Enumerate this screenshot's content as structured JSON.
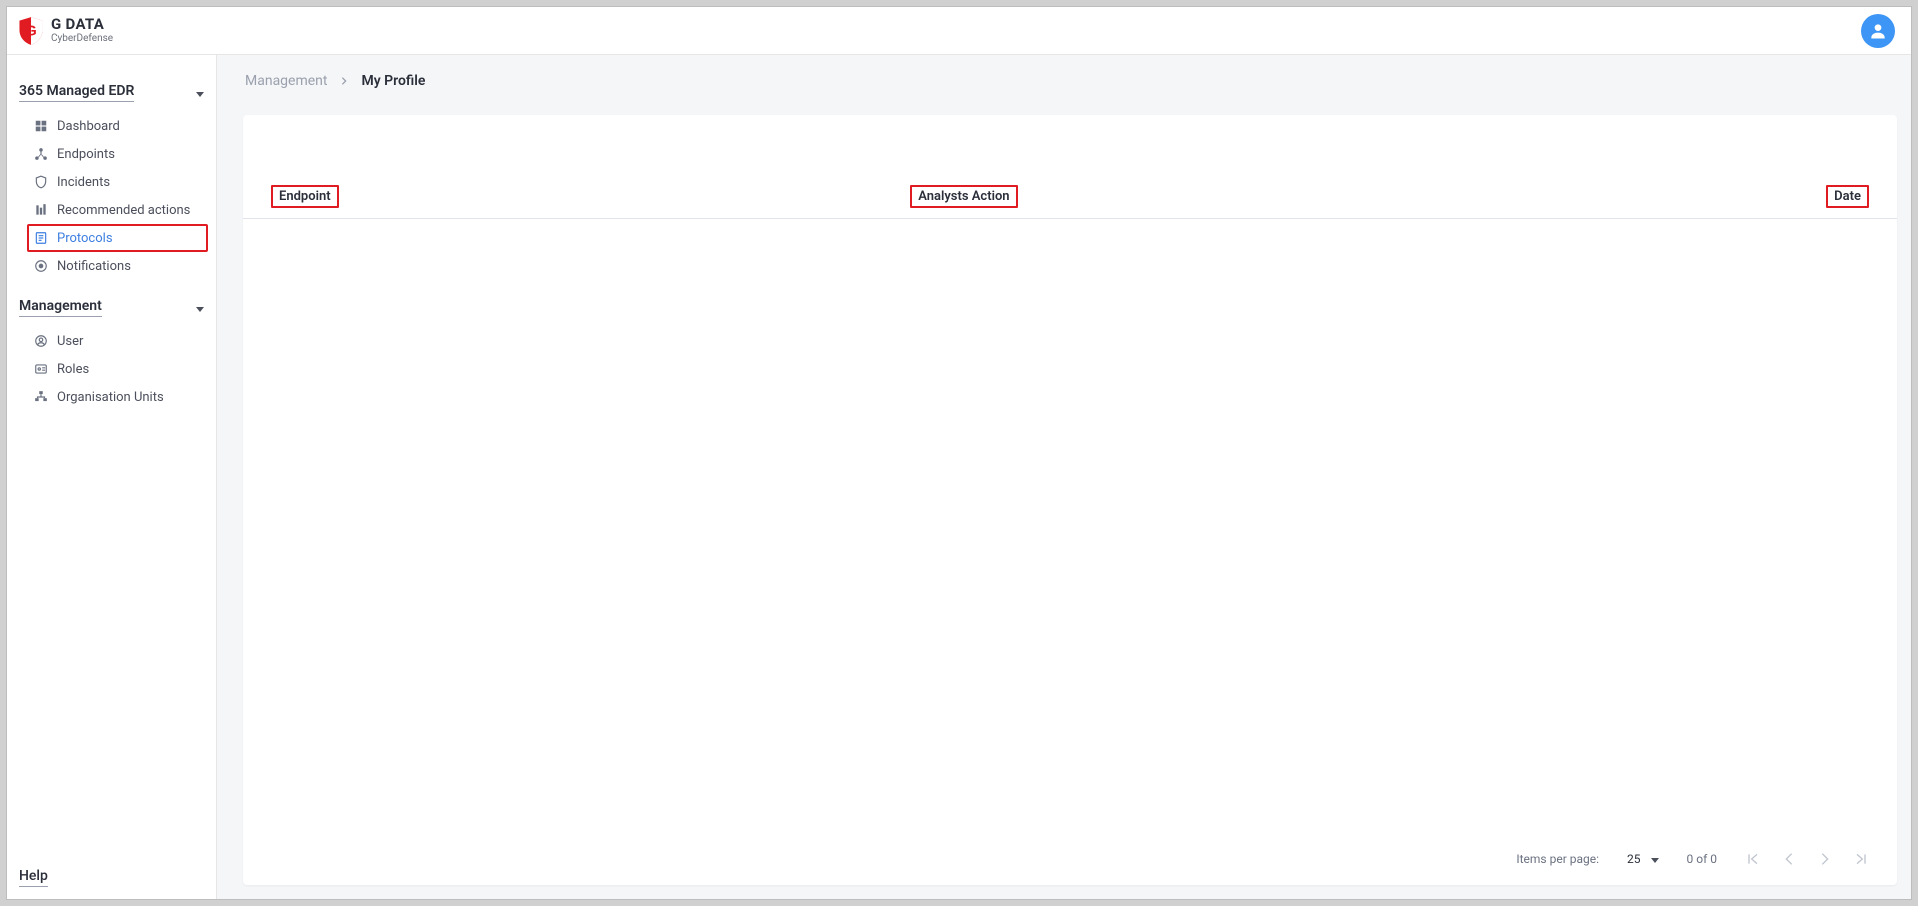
{
  "brand": {
    "main": "G DATA",
    "sub": "CyberDefense"
  },
  "sidebar": {
    "section1": {
      "title": "365 Managed EDR",
      "items": [
        {
          "label": "Dashboard"
        },
        {
          "label": "Endpoints"
        },
        {
          "label": "Incidents"
        },
        {
          "label": "Recommended actions"
        },
        {
          "label": "Protocols"
        },
        {
          "label": "Notifications"
        }
      ]
    },
    "section2": {
      "title": "Management",
      "items": [
        {
          "label": "User"
        },
        {
          "label": "Roles"
        },
        {
          "label": "Organisation Units"
        }
      ]
    },
    "help": "Help"
  },
  "breadcrumb": {
    "root": "Management",
    "current": "My Profile"
  },
  "table": {
    "columns": {
      "endpoint": "Endpoint",
      "action": "Analysts Action",
      "date": "Date"
    }
  },
  "pager": {
    "items_per_page_label": "Items per page:",
    "items_per_page_value": "25",
    "range": "0 of 0"
  }
}
